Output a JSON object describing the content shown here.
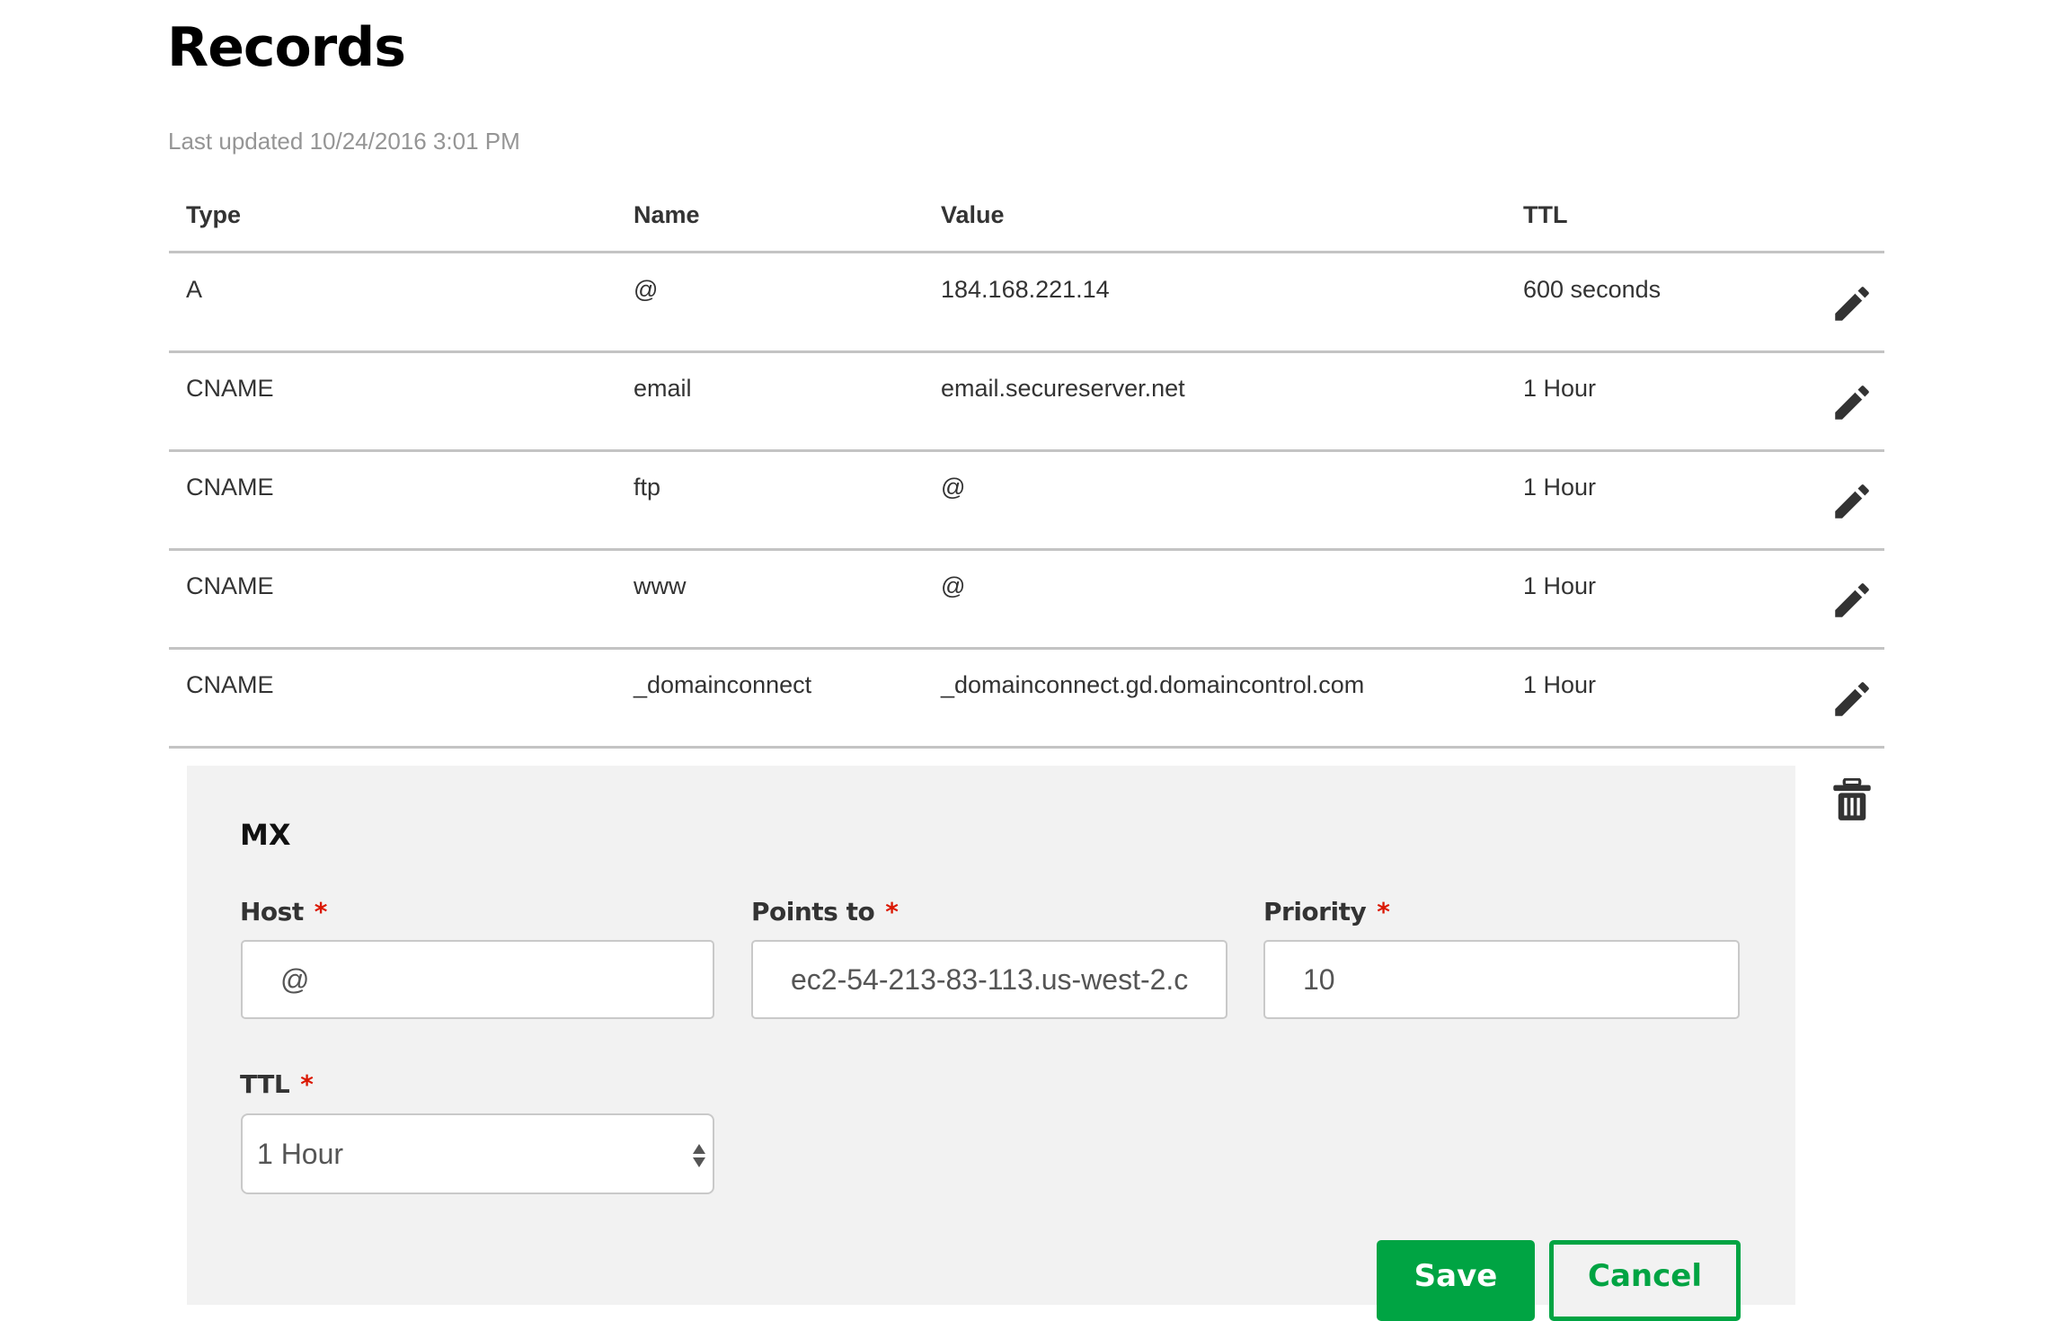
{
  "page": {
    "title": "Records",
    "last_updated": "Last updated 10/24/2016 3:01 PM"
  },
  "table": {
    "columns": [
      "Type",
      "Name",
      "Value",
      "TTL"
    ],
    "rows": [
      {
        "type": "A",
        "name": "@",
        "value": "184.168.221.14",
        "ttl": "600 seconds",
        "action_icon": "pencil-icon"
      },
      {
        "type": "CNAME",
        "name": "email",
        "value": "email.secureserver.net",
        "ttl": "1 Hour",
        "action_icon": "pencil-icon"
      },
      {
        "type": "CNAME",
        "name": "ftp",
        "value": "@",
        "ttl": "1 Hour",
        "action_icon": "pencil-icon"
      },
      {
        "type": "CNAME",
        "name": "www",
        "value": "@",
        "ttl": "1 Hour",
        "action_icon": "pencil-icon"
      },
      {
        "type": "CNAME",
        "name": "_domainconnect",
        "value": "_domainconnect.gd.domaincontrol.com",
        "ttl": "1 Hour",
        "action_icon": "pencil-icon"
      }
    ]
  },
  "edit_form": {
    "record_type": "MX",
    "delete_icon": "trash-icon",
    "required_marker": "*",
    "host": {
      "label": "Host",
      "value": "@"
    },
    "points_to": {
      "label": "Points to",
      "value": "ec2-54-213-83-113.us-west-2.c"
    },
    "priority": {
      "label": "Priority",
      "value": "10"
    },
    "ttl": {
      "label": "TTL",
      "selected": "1 Hour"
    },
    "save_label": "Save",
    "cancel_label": "Cancel"
  },
  "colors": {
    "accent_green": "#00a443",
    "required_red": "#db1802",
    "panel_bg": "#f2f2f2"
  }
}
